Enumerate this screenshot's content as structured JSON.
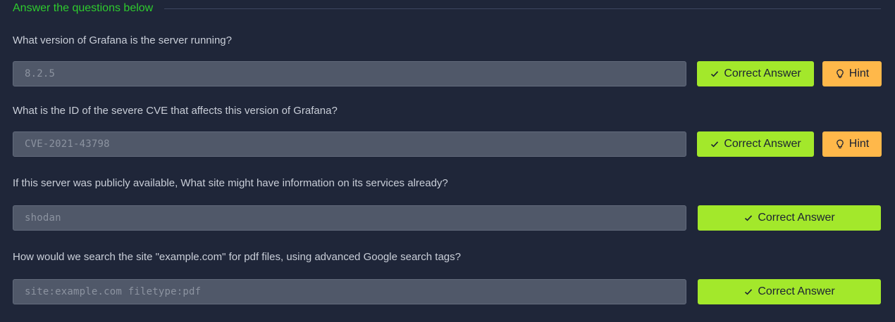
{
  "section": {
    "title": "Answer the questions below"
  },
  "questions": [
    {
      "question": "What version of Grafana is the server running?",
      "answer": "8.2.5",
      "correct_label": "Correct Answer",
      "hint_label": "Hint",
      "correct_icon": "check-icon",
      "hint_icon": "lightbulb-icon"
    },
    {
      "question": "What is the ID of the severe CVE that affects this version of Grafana?",
      "answer": "CVE-2021-43798",
      "correct_label": "Correct Answer",
      "hint_label": "Hint",
      "correct_icon": "check-icon",
      "hint_icon": "lightbulb-icon"
    },
    {
      "question": "If this server was publicly available, What site might have information on its services already?",
      "answer": "shodan",
      "correct_label": "Correct Answer",
      "correct_icon": "check-icon"
    },
    {
      "question": "How would we search the site \"example.com\" for pdf files, using advanced Google search tags?",
      "answer": "site:example.com filetype:pdf",
      "correct_label": "Correct Answer",
      "correct_icon": "check-icon"
    }
  ],
  "colors": {
    "background": "#1f2639",
    "section_title": "#2ecb2e",
    "correct_button": "#a3e82b",
    "hint_button": "#ffb84a",
    "answer_field": "#505869"
  }
}
